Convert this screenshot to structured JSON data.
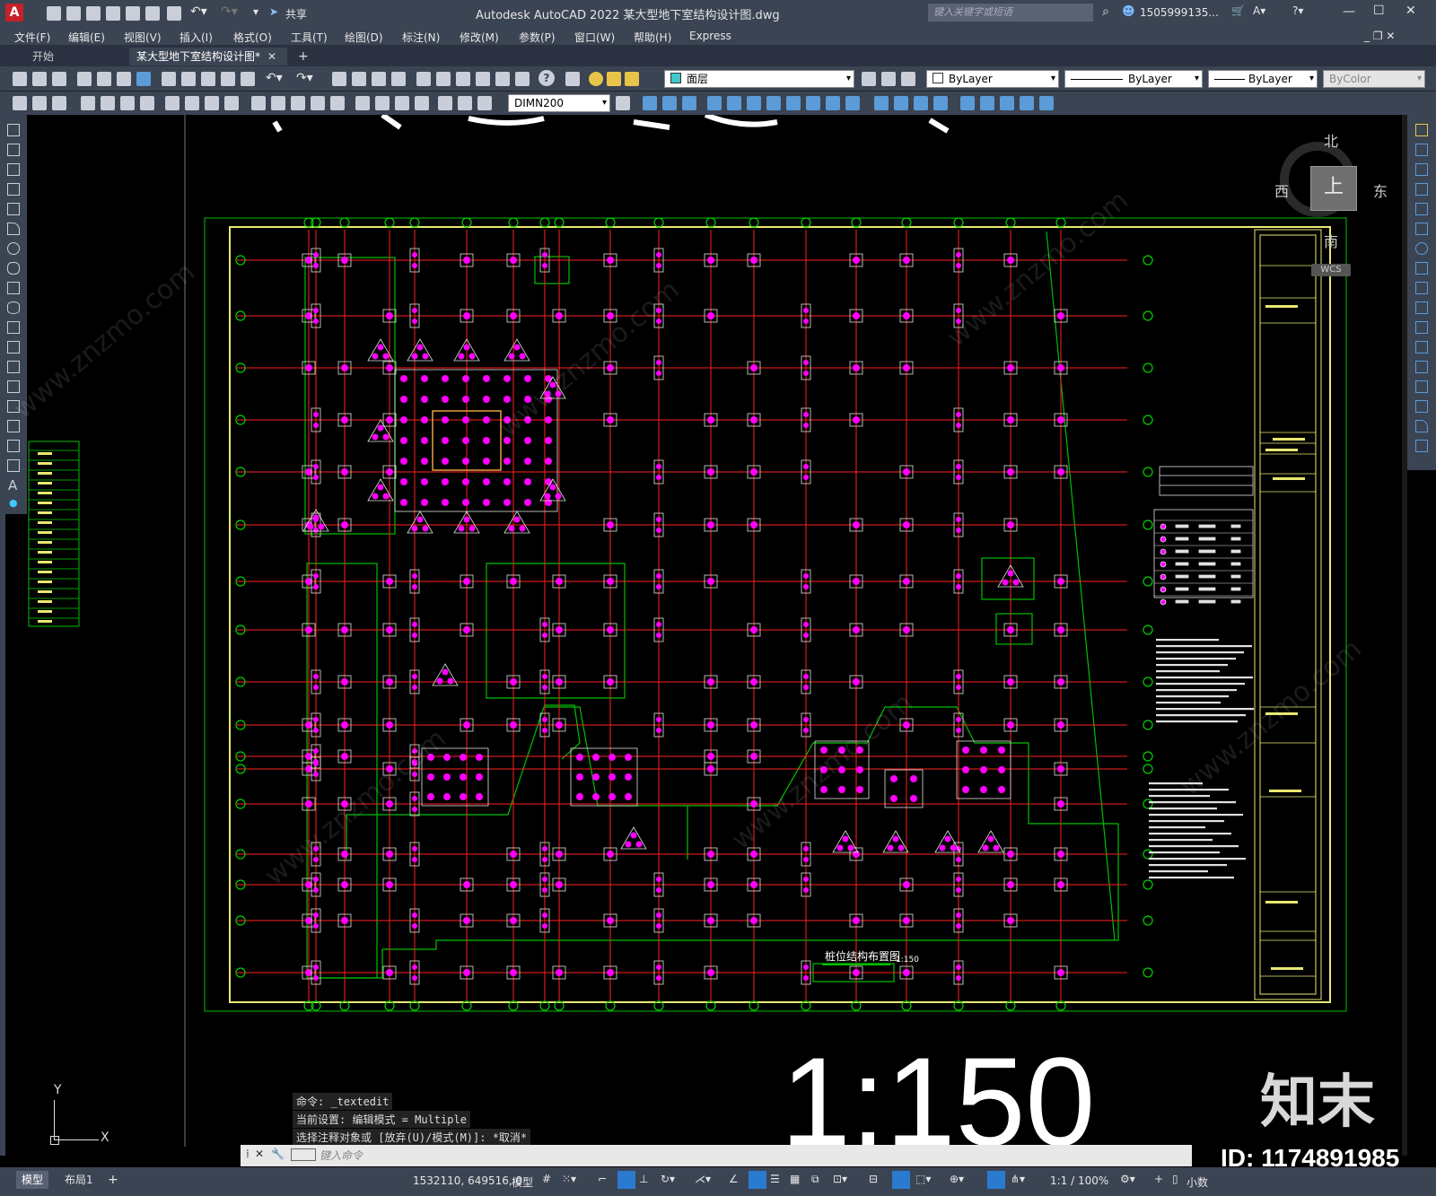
{
  "window": {
    "title": "Autodesk AutoCAD 2022    某大型地下室结构设计图.dwg",
    "share_label": "共享",
    "search_placeholder": "键入关键字或短语",
    "user": "1505999135...",
    "minimize": "—",
    "maximize": "☐",
    "close": "✕"
  },
  "menu": {
    "items": [
      "文件(F)",
      "编辑(E)",
      "视图(V)",
      "插入(I)",
      "格式(O)",
      "工具(T)",
      "绘图(D)",
      "标注(N)",
      "修改(M)",
      "参数(P)",
      "窗口(W)",
      "帮助(H)",
      "Express"
    ]
  },
  "tabs": {
    "start": "开始",
    "active": "某大型地下室结构设计图*",
    "close": "✕",
    "add": "+"
  },
  "toolbar": {
    "layer_value": "面层",
    "color_value": "ByLayer",
    "linetype_value": "ByLayer",
    "lineweight_value": "ByLayer",
    "plotstyle_value": "ByColor",
    "dimstyle_value": "DIMN200"
  },
  "viewcube": {
    "north": "北",
    "south": "南",
    "east": "东",
    "west": "西",
    "top": "上",
    "wcs": "WCS"
  },
  "drawing": {
    "plan_title": "桩位结构布置图",
    "plan_scale": "1:150",
    "overlay_scale": "1:150",
    "watermark_logo": "知末",
    "watermark_id": "ID: 1174891985",
    "watermark_url": "www.znzmo.com"
  },
  "ucs": {
    "y": "Y",
    "x": "X"
  },
  "command": {
    "history": [
      "命令: _textedit",
      "当前设置: 编辑模式 = Multiple",
      "选择注释对象或 [放弃(U)/模式(M)]: *取消*"
    ],
    "placeholder": "键入命令"
  },
  "statusbar": {
    "model_tab": "模型",
    "layout_tab": "布局1",
    "add_tab": "+",
    "coords": "1532110, 649516, 0",
    "model_label": "模型",
    "scale": "1:1 / 100%",
    "units": "小数"
  },
  "colors": {
    "chrome": "#3b4453",
    "canvas": "#000000",
    "axis_red": "#ff2020",
    "pile_magenta": "#ff00ff",
    "outline_green": "#00d000",
    "frame_yellow": "#e8e870"
  }
}
